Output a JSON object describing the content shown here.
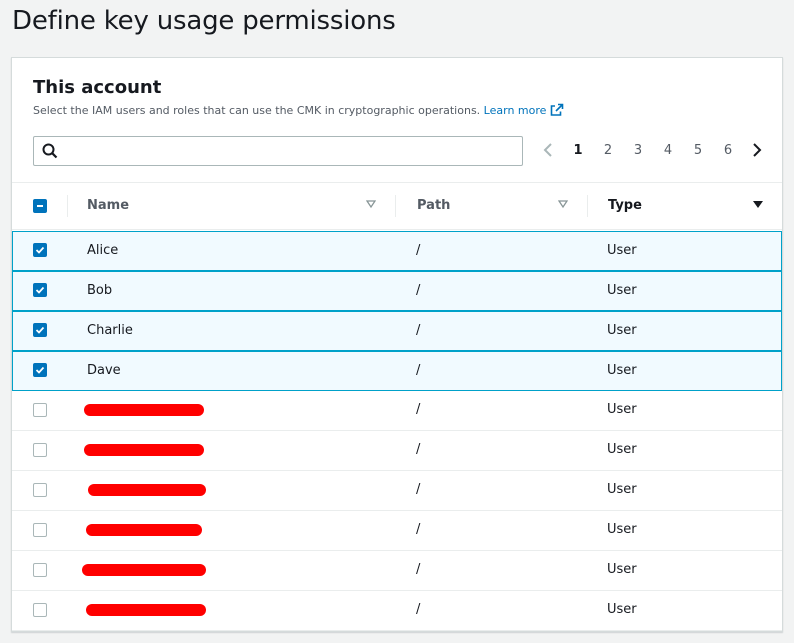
{
  "page": {
    "title": "Define key usage permissions"
  },
  "section": {
    "title": "This account",
    "description": "Select the IAM users and roles that can use the CMK in cryptographic operations.",
    "learn_more": "Learn more"
  },
  "search": {
    "placeholder": ""
  },
  "pagination": {
    "pages": [
      "1",
      "2",
      "3",
      "4",
      "5",
      "6"
    ],
    "current": "1"
  },
  "table": {
    "columns": {
      "name": "Name",
      "path": "Path",
      "type": "Type"
    },
    "rows": [
      {
        "name": "Alice",
        "path": "/",
        "type": "User",
        "checked": true
      },
      {
        "name": "Bob",
        "path": "/",
        "type": "User",
        "checked": true
      },
      {
        "name": "Charlie",
        "path": "/",
        "type": "User",
        "checked": true
      },
      {
        "name": "Dave",
        "path": "/",
        "type": "User",
        "checked": true
      },
      {
        "name": "",
        "path": "/",
        "type": "User",
        "checked": false,
        "redacted": true
      },
      {
        "name": "",
        "path": "/",
        "type": "User",
        "checked": false,
        "redacted": true
      },
      {
        "name": "",
        "path": "/",
        "type": "User",
        "checked": false,
        "redacted": true
      },
      {
        "name": "",
        "path": "/",
        "type": "User",
        "checked": false,
        "redacted": true
      },
      {
        "name": "",
        "path": "/",
        "type": "User",
        "checked": false,
        "redacted": true
      },
      {
        "name": "",
        "path": "/",
        "type": "User",
        "checked": false,
        "redacted": true
      }
    ]
  },
  "colors": {
    "accent": "#0073bb",
    "selected_bg": "#f1faff",
    "selected_border": "#00a1c9",
    "redaction": "#ff0000"
  },
  "icons": {
    "search": "search-icon",
    "external": "external-link-icon",
    "prev": "chevron-left-icon",
    "next": "chevron-right-icon"
  }
}
